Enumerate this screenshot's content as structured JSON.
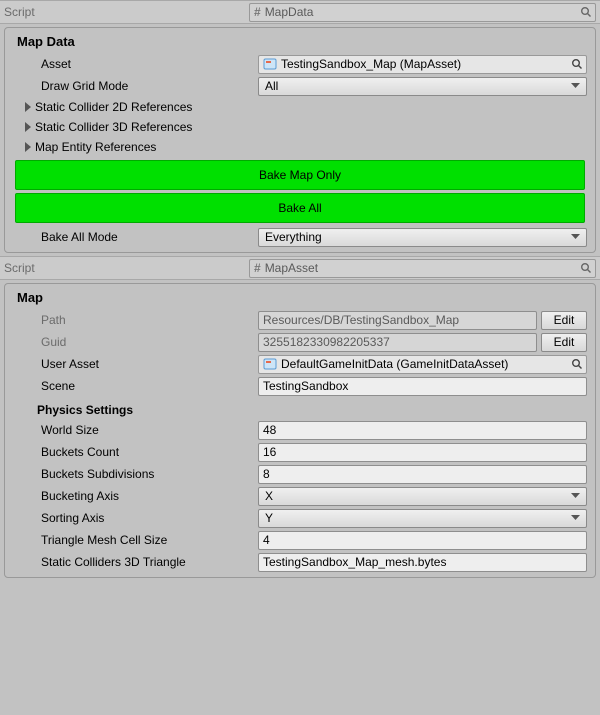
{
  "script_label": "Script",
  "component1": {
    "script_name": "MapData",
    "section_title": "Map Data",
    "asset_label": "Asset",
    "asset_value": "TestingSandbox_Map (MapAsset)",
    "draw_grid_label": "Draw Grid Mode",
    "draw_grid_value": "All",
    "foldouts": {
      "f0": "Static Collider 2D References",
      "f1": "Static Collider 3D References",
      "f2": "Map Entity References"
    },
    "bake_map_only": "Bake Map Only",
    "bake_all": "Bake All",
    "bake_all_mode_label": "Bake All Mode",
    "bake_all_mode_value": "Everything"
  },
  "component2": {
    "script_name": "MapAsset",
    "section_title": "Map",
    "path_label": "Path",
    "path_value": "Resources/DB/TestingSandbox_Map",
    "guid_label": "Guid",
    "guid_value": "3255182330982205337",
    "edit_label": "Edit",
    "user_asset_label": "User Asset",
    "user_asset_value": "DefaultGameInitData (GameInitDataAsset)",
    "scene_label": "Scene",
    "scene_value": "TestingSandbox",
    "physics_heading": "Physics Settings",
    "world_size_label": "World Size",
    "world_size_value": "48",
    "buckets_count_label": "Buckets Count",
    "buckets_count_value": "16",
    "buckets_sub_label": "Buckets Subdivisions",
    "buckets_sub_value": "8",
    "bucketing_axis_label": "Bucketing Axis",
    "bucketing_axis_value": "X",
    "sorting_axis_label": "Sorting Axis",
    "sorting_axis_value": "Y",
    "tri_cell_label": "Triangle Mesh Cell Size",
    "tri_cell_value": "4",
    "static3d_label": "Static Colliders 3D Triangle",
    "static3d_value": "TestingSandbox_Map_mesh.bytes"
  }
}
